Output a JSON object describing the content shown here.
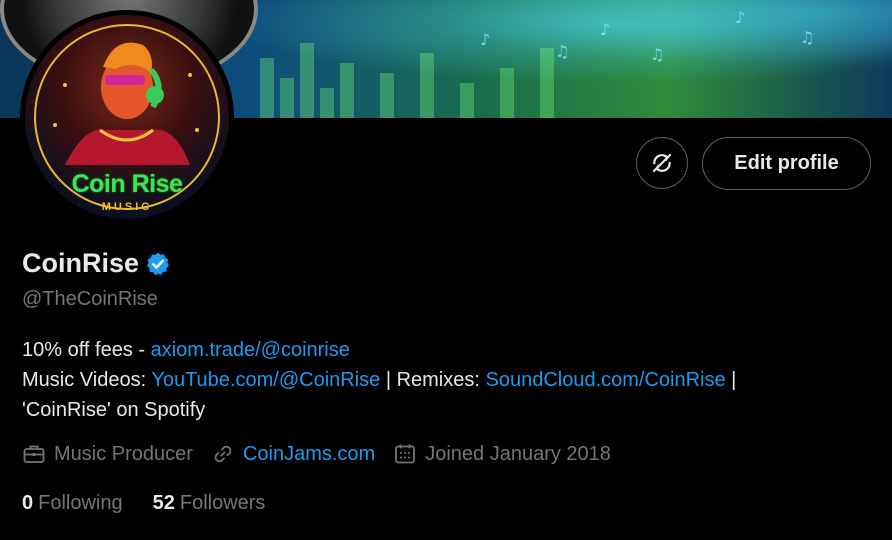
{
  "avatar": {
    "line1": "Coin Rise",
    "line2": "MUSIC"
  },
  "actions": {
    "icon_button": "no-sync-icon",
    "edit_label": "Edit profile"
  },
  "profile": {
    "display_name": "CoinRise",
    "handle": "@TheCoinRise",
    "verified_icon": "verified-badge-icon",
    "verified_color": "#1d9bf0"
  },
  "bio": {
    "l1_text": "10% off fees - ",
    "l1_link": "axiom.trade/@coinrise",
    "l2_text_a": "Music Videos: ",
    "l2_link_a": "YouTube.com/@CoinRise",
    "l2_text_b": " | Remixes: ",
    "l2_link_b": "SoundCloud.com/CoinRise",
    "l2_text_c": " |",
    "l3_text": "'CoinRise' on Spotify"
  },
  "meta": {
    "profession": "Music Producer",
    "website": "CoinJams.com",
    "joined": "Joined January 2018"
  },
  "stats": {
    "following_count": "0",
    "following_label": "Following",
    "followers_count": "52",
    "followers_label": "Followers"
  },
  "colors": {
    "link": "#1d9bf0",
    "muted": "#71767b",
    "text": "#e7e9ea",
    "background": "#000000"
  }
}
